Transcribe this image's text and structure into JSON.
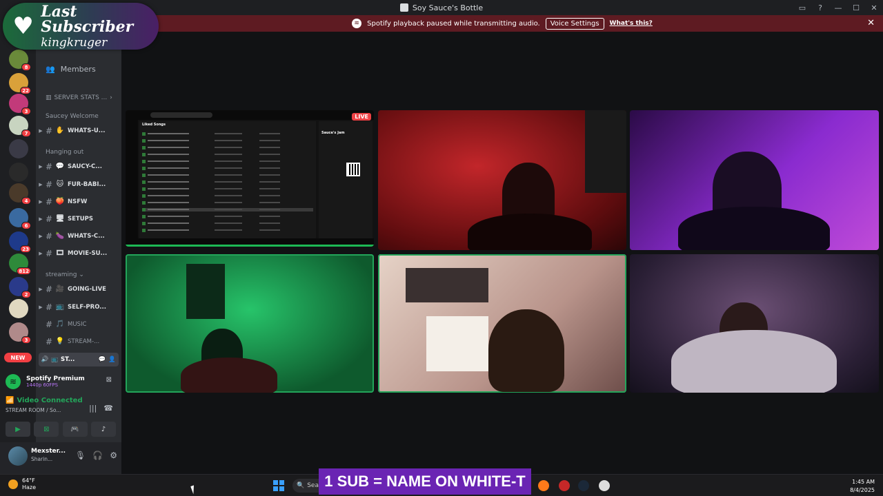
{
  "window": {
    "title": "Soy Sauce's Bottle"
  },
  "banner": {
    "message": "Spotify playback paused while transmitting audio.",
    "voice_settings_label": "Voice Settings",
    "whats_this_label": "What's this?"
  },
  "last_subscriber": {
    "title": "Last Subscriber",
    "name": "kingkruger"
  },
  "servers": {
    "badges": [
      "8",
      "22",
      "3",
      "7",
      "4",
      "6",
      "23",
      "812",
      "2",
      "3"
    ],
    "new_label": "NEW"
  },
  "sidebar": {
    "members_label": "Members",
    "server_stats": "SERVER STATS ...",
    "categories": {
      "welcome": "Saucey Welcome",
      "hanging_out": "Hanging out",
      "streaming": "streaming"
    },
    "channels": {
      "whats_up": "WHATS-U...",
      "saucy_chat": "SAUCY-C...",
      "fur_babies": "FUR-BABI...",
      "nsfw": "NSFW",
      "setups": "SETUPS",
      "whats_cooking": "WHATS-C...",
      "movie_suggestions": "MOVIE-SU...",
      "going_live": "GOING-LIVE",
      "self_promo": "SELF-PRO...",
      "music": "MUSIC",
      "stream_chat": "STREAM-...",
      "voice_stream": "ST..."
    }
  },
  "spotify_panel": {
    "title": "Spotify Premium",
    "sub": "1440p 60FPS"
  },
  "voice_panel": {
    "status": "Video Connected",
    "location": "STREAM ROOM / So..."
  },
  "user_panel": {
    "name": "Mexster...",
    "status": "Sharin..."
  },
  "stream": {
    "live_label": "LIVE",
    "playlist_title": "Liked Songs",
    "right_title": "Sauce's Jam"
  },
  "overlay": {
    "sub_text": "1 SUB = NAME ON WHITE-T"
  },
  "taskbar": {
    "weather_temp": "64°F",
    "weather_desc": "Haze",
    "search_label": "Sear",
    "time": "1:45 AM",
    "date": "8/4/2025"
  },
  "colors": {
    "accent_green": "#23a55a",
    "banner_red": "#5e1b22",
    "badge_red": "#f23f43",
    "overlay_purple": "#6a24b3"
  }
}
